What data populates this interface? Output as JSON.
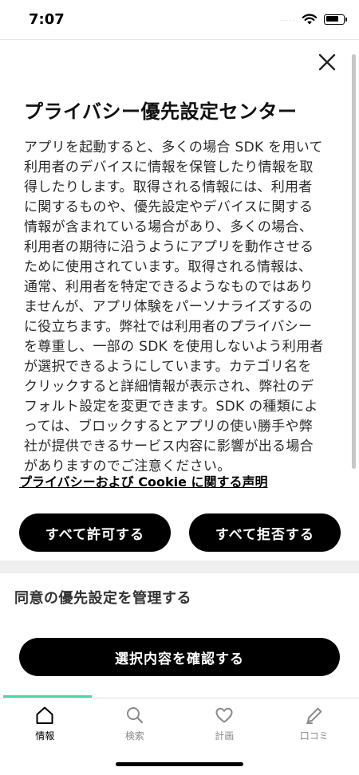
{
  "status_bar": {
    "time": "7:07",
    "signal": "....."
  },
  "title": "プライバシー優先設定センター",
  "body_lines": [
    "アプリを起動すると、多くの場合 SDK を用いて",
    "利用者のデバイスに情報を保管したり情報を取",
    "得したりします。取得される情報には、利用者",
    "に関するものや、優先設定やデバイスに関する",
    "情報が含まれている場合があり、多くの場合、",
    "利用者の期待に沿うようにアプリを動作させる",
    "ために使用されています。取得される情報は、",
    "通常、利用者を特定できるようなものではあり",
    "ませんが、アプリ体験をパーソナライズするの",
    "に役立ちます。弊社では利用者のプライバシー",
    "を尊重し、一部の SDK を使用しないよう利用者",
    "が選択できるようにしています。カテゴリ名を",
    "クリックすると詳細情報が表示され、弊社のデ",
    "フォルト設定を変更できます。SDK の種類によ",
    "っては、ブロックするとアプリの使い勝手や弊",
    "社が提供できるサービス内容に影響が出る場合",
    "がありますのでご注意ください。"
  ],
  "policy_link": "プライバシーおよび Cookie に関する声明",
  "buttons": {
    "allow_all": "すべて許可する",
    "reject_all": "すべて拒否する",
    "confirm": "選択内容を確認する"
  },
  "manage_heading": "同意の優先設定を管理する",
  "tabs": [
    {
      "label": "情報",
      "icon": "home-icon",
      "active": true
    },
    {
      "label": "検索",
      "icon": "search-icon",
      "active": false
    },
    {
      "label": "計画",
      "icon": "heart-icon",
      "active": false
    },
    {
      "label": "口コミ",
      "icon": "pencil-icon",
      "active": false
    }
  ]
}
